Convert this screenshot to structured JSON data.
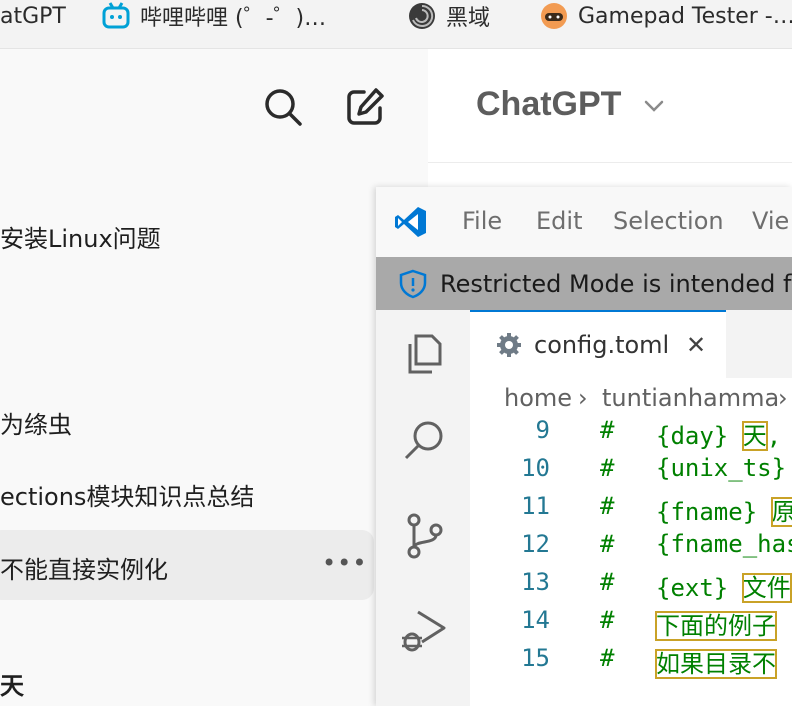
{
  "bookmarks": [
    {
      "label": "atGPT",
      "icon": "chatgpt-bookmark"
    },
    {
      "label": "哔哩哔哩 (゜-゜)…",
      "icon": "bilibili-icon"
    },
    {
      "label": "黑域",
      "icon": "blackdomain-icon"
    },
    {
      "label": "Gamepad Tester -…",
      "icon": "gamepad-tester-icon"
    }
  ],
  "sidebar": {
    "search_icon": "search-icon",
    "new_chat_icon": "new-chat-icon",
    "history": [
      "安装Linux问题",
      "为绦虫",
      "ections模块知识点总结",
      "不能直接实例化"
    ],
    "more_label": "•••",
    "section_heading": "天"
  },
  "main": {
    "model_title": "ChatGPT"
  },
  "vscode": {
    "menu": [
      "File",
      "Edit",
      "Selection",
      "Vie"
    ],
    "restricted_text": "Restricted Mode is intended for s",
    "tab_label": "config.toml",
    "tab_close": "✕",
    "breadcrumb": [
      "home",
      "tuntianhamma"
    ],
    "breadcrumb_sep": "›",
    "lines": [
      {
        "n": "9",
        "hash": "#",
        "code": "{day} ",
        "hl": "天",
        "rest": ","
      },
      {
        "n": "10",
        "hash": "#",
        "code": "{unix_ts}",
        "hl": "",
        "rest": ""
      },
      {
        "n": "11",
        "hash": "#",
        "code": "{fname} ",
        "hl": "原",
        "rest": ""
      },
      {
        "n": "12",
        "hash": "#",
        "code": "{fname_has",
        "hl": "",
        "rest": ""
      },
      {
        "n": "13",
        "hash": "#",
        "code": "{ext} ",
        "hl": "文件",
        "rest": ""
      },
      {
        "n": "14",
        "hash": "#",
        "code": "",
        "hl": "下面的例子",
        "rest": ""
      },
      {
        "n": "15",
        "hash": "#",
        "code": "",
        "hl": "如果目录不",
        "rest": ""
      }
    ],
    "colors": {
      "accent": "#0078d4",
      "comment": "#008000",
      "line_number": "#237893",
      "highlight": "#c9a227"
    }
  }
}
